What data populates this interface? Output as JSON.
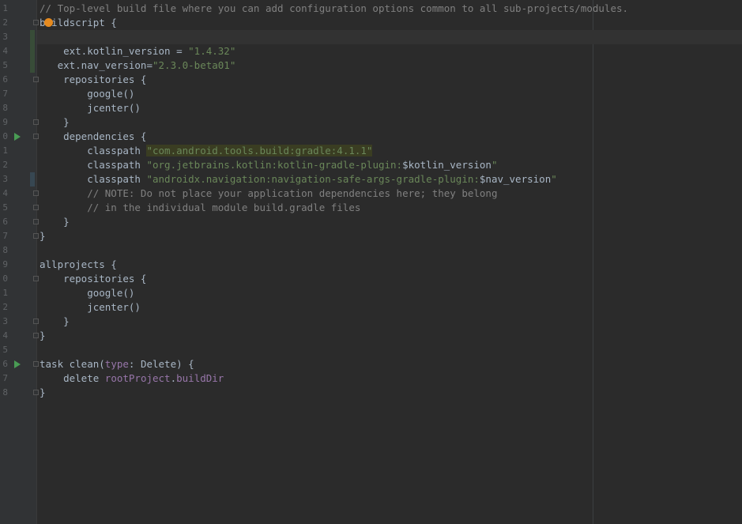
{
  "editor": {
    "language": "gradle",
    "colors": {
      "background": "#2b2b2b",
      "gutter": "#313335",
      "text": "#a9b7c6",
      "comment": "#808080",
      "string": "#6a8759",
      "property": "#9876aa",
      "line_number": "#606366",
      "run_icon": "#499c54",
      "intention_bulb": "#e58a1f"
    },
    "intention_icon": "bulb-icon",
    "run_icon": "run-gutter-icon",
    "fold_icon": "fold-marker-icon"
  },
  "lines": [
    {
      "number": "1",
      "text": "// Top-level build file where you can add configuration options common to all sub-projects/modules."
    },
    {
      "number": "2",
      "text": "buildscript {"
    },
    {
      "number": "3",
      "text": ""
    },
    {
      "number": "4",
      "a": "    ext.kotlin_version = ",
      "b": "\"1.4.32\""
    },
    {
      "number": "5",
      "a": "   ext.nav_version=",
      "b": "\"2.3.0-beta01\""
    },
    {
      "number": "6",
      "text": "    repositories {"
    },
    {
      "number": "7",
      "text": "        google()"
    },
    {
      "number": "8",
      "text": "        jcenter()"
    },
    {
      "number": "9",
      "text": "    }"
    },
    {
      "number": "0",
      "text": "    dependencies {"
    },
    {
      "number": "1",
      "a": "        classpath ",
      "b": "\"com.android.tools.build:gradle:4.1.1\""
    },
    {
      "number": "2",
      "a": "        classpath ",
      "b": "\"org.jetbrains.kotlin:kotlin-gradle-plugin:",
      "c": "$kotlin_version",
      "d": "\""
    },
    {
      "number": "3",
      "a": "        classpath ",
      "b": "\"androidx.navigation:navigation-safe-args-gradle-plugin:",
      "c": "$nav_version",
      "d": "\""
    },
    {
      "number": "4",
      "text": "        // NOTE: Do not place your application dependencies here; they belong"
    },
    {
      "number": "5",
      "text": "        // in the individual module build.gradle files"
    },
    {
      "number": "6",
      "text": "    }"
    },
    {
      "number": "7",
      "text": "}"
    },
    {
      "number": "8",
      "text": ""
    },
    {
      "number": "9",
      "text": "allprojects {"
    },
    {
      "number": "0",
      "text": "    repositories {"
    },
    {
      "number": "1",
      "text": "        google()"
    },
    {
      "number": "2",
      "text": "        jcenter()"
    },
    {
      "number": "3",
      "text": "    }"
    },
    {
      "number": "4",
      "text": "}"
    },
    {
      "number": "5",
      "text": ""
    },
    {
      "number": "6",
      "a": "task clean(",
      "b": "type",
      "c": ": Delete) {"
    },
    {
      "number": "7",
      "a": "    delete ",
      "b": "rootProject",
      "c": ".",
      "d": "buildDir"
    },
    {
      "number": "8",
      "text": "}"
    }
  ]
}
